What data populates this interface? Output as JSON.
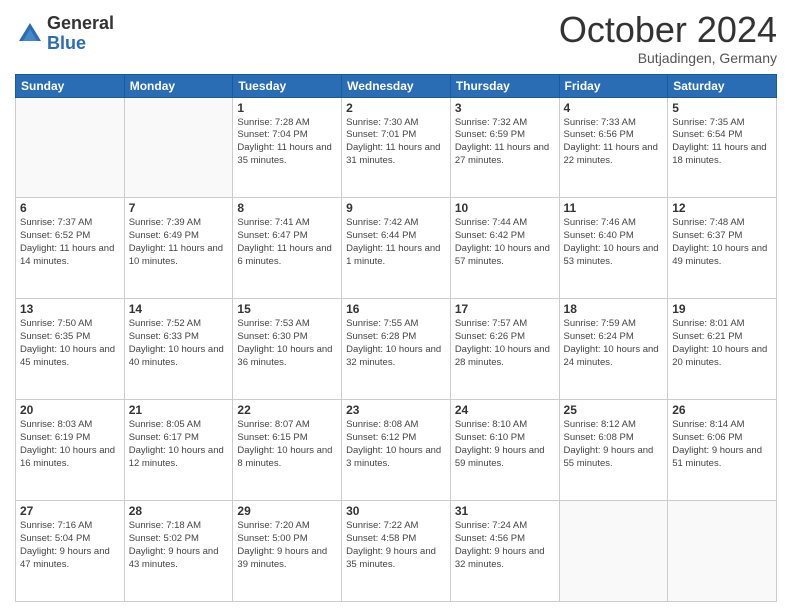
{
  "logo": {
    "general": "General",
    "blue": "Blue"
  },
  "header": {
    "month": "October 2024",
    "location": "Butjadingen, Germany"
  },
  "weekdays": [
    "Sunday",
    "Monday",
    "Tuesday",
    "Wednesday",
    "Thursday",
    "Friday",
    "Saturday"
  ],
  "weeks": [
    [
      {
        "day": "",
        "info": ""
      },
      {
        "day": "",
        "info": ""
      },
      {
        "day": "1",
        "info": "Sunrise: 7:28 AM\nSunset: 7:04 PM\nDaylight: 11 hours and 35 minutes."
      },
      {
        "day": "2",
        "info": "Sunrise: 7:30 AM\nSunset: 7:01 PM\nDaylight: 11 hours and 31 minutes."
      },
      {
        "day": "3",
        "info": "Sunrise: 7:32 AM\nSunset: 6:59 PM\nDaylight: 11 hours and 27 minutes."
      },
      {
        "day": "4",
        "info": "Sunrise: 7:33 AM\nSunset: 6:56 PM\nDaylight: 11 hours and 22 minutes."
      },
      {
        "day": "5",
        "info": "Sunrise: 7:35 AM\nSunset: 6:54 PM\nDaylight: 11 hours and 18 minutes."
      }
    ],
    [
      {
        "day": "6",
        "info": "Sunrise: 7:37 AM\nSunset: 6:52 PM\nDaylight: 11 hours and 14 minutes."
      },
      {
        "day": "7",
        "info": "Sunrise: 7:39 AM\nSunset: 6:49 PM\nDaylight: 11 hours and 10 minutes."
      },
      {
        "day": "8",
        "info": "Sunrise: 7:41 AM\nSunset: 6:47 PM\nDaylight: 11 hours and 6 minutes."
      },
      {
        "day": "9",
        "info": "Sunrise: 7:42 AM\nSunset: 6:44 PM\nDaylight: 11 hours and 1 minute."
      },
      {
        "day": "10",
        "info": "Sunrise: 7:44 AM\nSunset: 6:42 PM\nDaylight: 10 hours and 57 minutes."
      },
      {
        "day": "11",
        "info": "Sunrise: 7:46 AM\nSunset: 6:40 PM\nDaylight: 10 hours and 53 minutes."
      },
      {
        "day": "12",
        "info": "Sunrise: 7:48 AM\nSunset: 6:37 PM\nDaylight: 10 hours and 49 minutes."
      }
    ],
    [
      {
        "day": "13",
        "info": "Sunrise: 7:50 AM\nSunset: 6:35 PM\nDaylight: 10 hours and 45 minutes."
      },
      {
        "day": "14",
        "info": "Sunrise: 7:52 AM\nSunset: 6:33 PM\nDaylight: 10 hours and 40 minutes."
      },
      {
        "day": "15",
        "info": "Sunrise: 7:53 AM\nSunset: 6:30 PM\nDaylight: 10 hours and 36 minutes."
      },
      {
        "day": "16",
        "info": "Sunrise: 7:55 AM\nSunset: 6:28 PM\nDaylight: 10 hours and 32 minutes."
      },
      {
        "day": "17",
        "info": "Sunrise: 7:57 AM\nSunset: 6:26 PM\nDaylight: 10 hours and 28 minutes."
      },
      {
        "day": "18",
        "info": "Sunrise: 7:59 AM\nSunset: 6:24 PM\nDaylight: 10 hours and 24 minutes."
      },
      {
        "day": "19",
        "info": "Sunrise: 8:01 AM\nSunset: 6:21 PM\nDaylight: 10 hours and 20 minutes."
      }
    ],
    [
      {
        "day": "20",
        "info": "Sunrise: 8:03 AM\nSunset: 6:19 PM\nDaylight: 10 hours and 16 minutes."
      },
      {
        "day": "21",
        "info": "Sunrise: 8:05 AM\nSunset: 6:17 PM\nDaylight: 10 hours and 12 minutes."
      },
      {
        "day": "22",
        "info": "Sunrise: 8:07 AM\nSunset: 6:15 PM\nDaylight: 10 hours and 8 minutes."
      },
      {
        "day": "23",
        "info": "Sunrise: 8:08 AM\nSunset: 6:12 PM\nDaylight: 10 hours and 3 minutes."
      },
      {
        "day": "24",
        "info": "Sunrise: 8:10 AM\nSunset: 6:10 PM\nDaylight: 9 hours and 59 minutes."
      },
      {
        "day": "25",
        "info": "Sunrise: 8:12 AM\nSunset: 6:08 PM\nDaylight: 9 hours and 55 minutes."
      },
      {
        "day": "26",
        "info": "Sunrise: 8:14 AM\nSunset: 6:06 PM\nDaylight: 9 hours and 51 minutes."
      }
    ],
    [
      {
        "day": "27",
        "info": "Sunrise: 7:16 AM\nSunset: 5:04 PM\nDaylight: 9 hours and 47 minutes."
      },
      {
        "day": "28",
        "info": "Sunrise: 7:18 AM\nSunset: 5:02 PM\nDaylight: 9 hours and 43 minutes."
      },
      {
        "day": "29",
        "info": "Sunrise: 7:20 AM\nSunset: 5:00 PM\nDaylight: 9 hours and 39 minutes."
      },
      {
        "day": "30",
        "info": "Sunrise: 7:22 AM\nSunset: 4:58 PM\nDaylight: 9 hours and 35 minutes."
      },
      {
        "day": "31",
        "info": "Sunrise: 7:24 AM\nSunset: 4:56 PM\nDaylight: 9 hours and 32 minutes."
      },
      {
        "day": "",
        "info": ""
      },
      {
        "day": "",
        "info": ""
      }
    ]
  ]
}
